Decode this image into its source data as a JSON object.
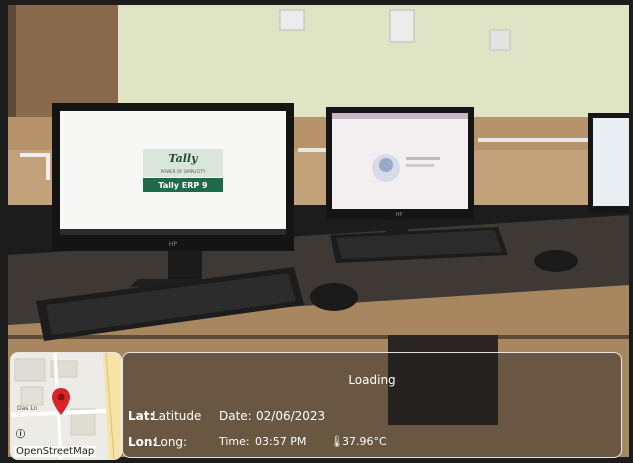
{
  "photo": {
    "monitor_left_logo": "Tally",
    "monitor_left_tagline": "POWER OF SIMPLICITY",
    "monitor_left_product": "Tally ERP 9",
    "monitor_right_brand": "HP",
    "monitor_left_brand": "HP"
  },
  "map": {
    "attribution": "OpenStreetMap",
    "info_icon": "info-icon",
    "street_label": "Das Ln"
  },
  "info": {
    "status": "Loading",
    "lat_key": "Lat:",
    "lat_val": "Latitude",
    "lon_key": "Lon:",
    "lon_val": "Long:",
    "date_key": "Date:",
    "date_val": "02/06/2023",
    "time_key": "Time:",
    "time_val": "03:57 PM",
    "temp_icon": "thermometer-icon",
    "temp_val": "37.96°C"
  },
  "colors": {
    "wall": "#dfe6c5",
    "desk": "#3d3833",
    "desk_panel": "#a98a66",
    "tally_green": "#1e6b4a"
  }
}
